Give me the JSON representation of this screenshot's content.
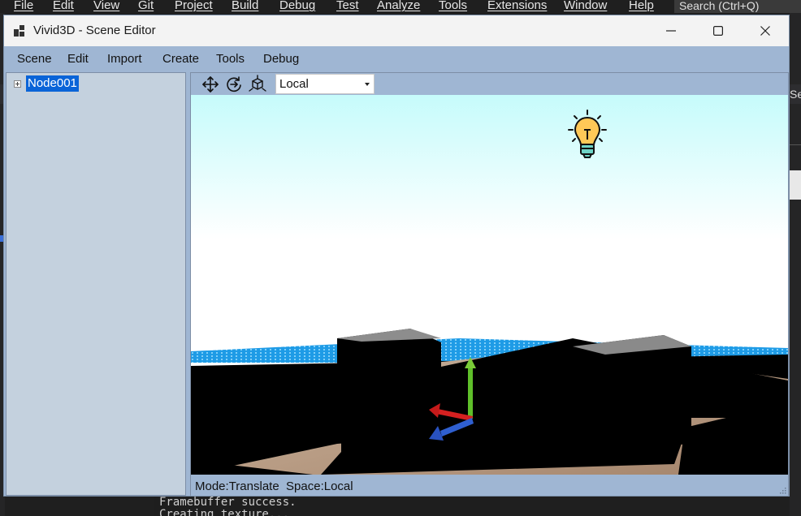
{
  "ide": {
    "menu": [
      "File",
      "Edit",
      "View",
      "Git",
      "Project",
      "Build",
      "Debug",
      "Test",
      "Analyze",
      "Tools",
      "Extensions",
      "Window",
      "Help"
    ],
    "search_placeholder": "Search (Ctrl+Q)",
    "right_tab_text": "Se",
    "output_lines": [
      "Framebuffer success.",
      "Creating texture..."
    ]
  },
  "window": {
    "title": "Vivid3D - Scene Editor",
    "controls": {
      "minimize": "minimize",
      "maximize": "maximize",
      "close": "close"
    }
  },
  "menubar": [
    "Scene",
    "Edit",
    "Import",
    "Create",
    "Tools",
    "Debug"
  ],
  "tree": {
    "nodes": [
      {
        "label": "Node001",
        "expanded": false,
        "selected": true
      }
    ]
  },
  "toolbar": {
    "tools": [
      "translate-icon",
      "rotate-icon",
      "scale-icon"
    ],
    "space_selected": "Local",
    "space_options": [
      "Local"
    ]
  },
  "status": {
    "mode_label": "Mode:",
    "mode_value": "Translate",
    "space_label": "Space:",
    "space_value": "Local"
  },
  "colors": {
    "window_chrome": "#9fb6d3",
    "tree_bg": "#c4d1de",
    "selection": "#0a64d8",
    "sky_top": "#c6fbfb",
    "gizmo_x": "#d42020",
    "gizmo_y": "#5fbf2a",
    "gizmo_z": "#2f5fd0",
    "light_bulb": "#ffc857"
  }
}
